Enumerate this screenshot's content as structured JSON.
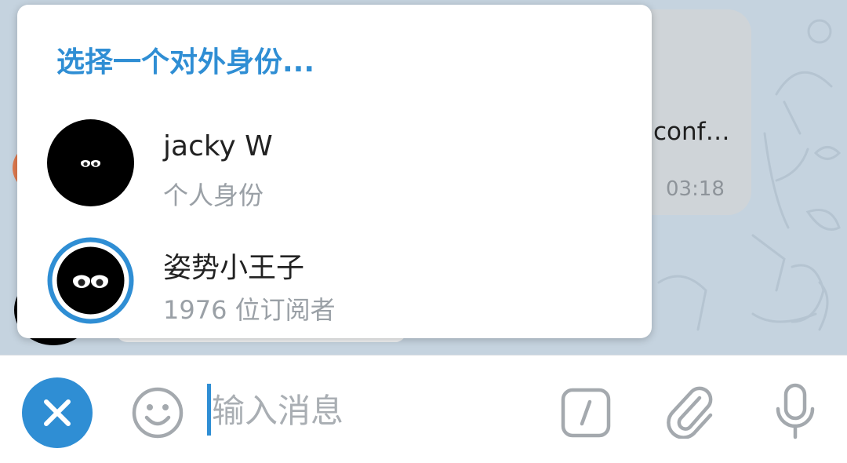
{
  "chat": {
    "message_snippet": "conf…",
    "message_time": "03:18"
  },
  "identity_popup": {
    "title": "选择一个对外身份...",
    "identities": [
      {
        "name": "jacky W",
        "subtitle": "个人身份",
        "selected": false
      },
      {
        "name": "姿势小王子",
        "subtitle": "1976 位订阅者",
        "selected": true
      }
    ]
  },
  "input_bar": {
    "placeholder": "输入消息",
    "value": "",
    "icons": {
      "close": "close-icon",
      "emoji": "smiley-icon",
      "command": "slash-command-icon",
      "attach": "paperclip-icon",
      "mic": "microphone-icon"
    }
  },
  "colors": {
    "accent": "#2f8ed4",
    "chat_background": "#c5d3df",
    "bubble": "#cfd4d8",
    "muted_text": "#9aa0a6",
    "icon_gray": "#a4a9ae"
  }
}
